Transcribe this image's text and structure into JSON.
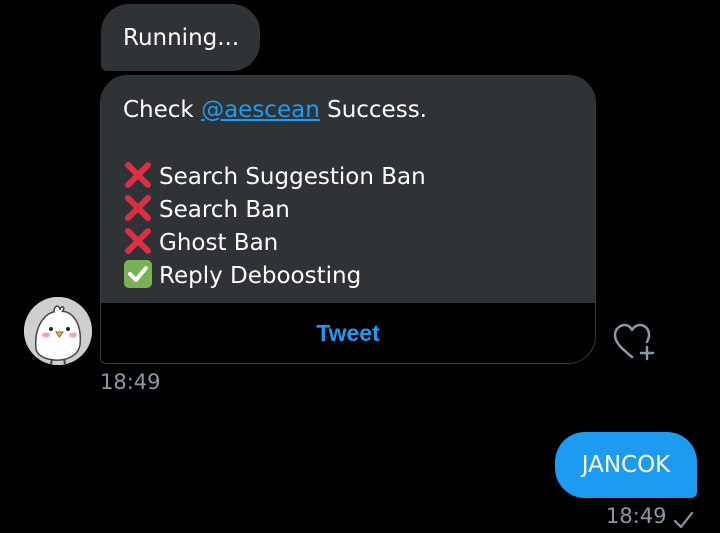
{
  "messages": {
    "running": {
      "text": "Running..."
    },
    "result": {
      "prefix": "Check ",
      "mention": "@aescean",
      "suffix": " Success.",
      "items": [
        {
          "status": "fail",
          "icon": "cross-mark-icon",
          "label": "Search Suggestion Ban"
        },
        {
          "status": "fail",
          "icon": "cross-mark-icon",
          "label": "Search Ban"
        },
        {
          "status": "fail",
          "icon": "cross-mark-icon",
          "label": "Ghost Ban"
        },
        {
          "status": "pass",
          "icon": "check-mark-icon",
          "label": "Reply Deboosting"
        }
      ],
      "action_label": "Tweet"
    },
    "received_time": "18:49",
    "sent": {
      "text": "JANCOK",
      "time": "18:49"
    }
  },
  "icons": {
    "avatar": "chick-avatar",
    "react": "heart-plus-icon",
    "sent_status": "check-icon"
  },
  "colors": {
    "background": "#000000",
    "received_bubble": "#2f3336",
    "sent_bubble": "#1d9bf0",
    "accent": "#1d9bf0",
    "fail": "#dd2e44",
    "pass": "#77b255",
    "timestamp": "#8b98a5"
  }
}
